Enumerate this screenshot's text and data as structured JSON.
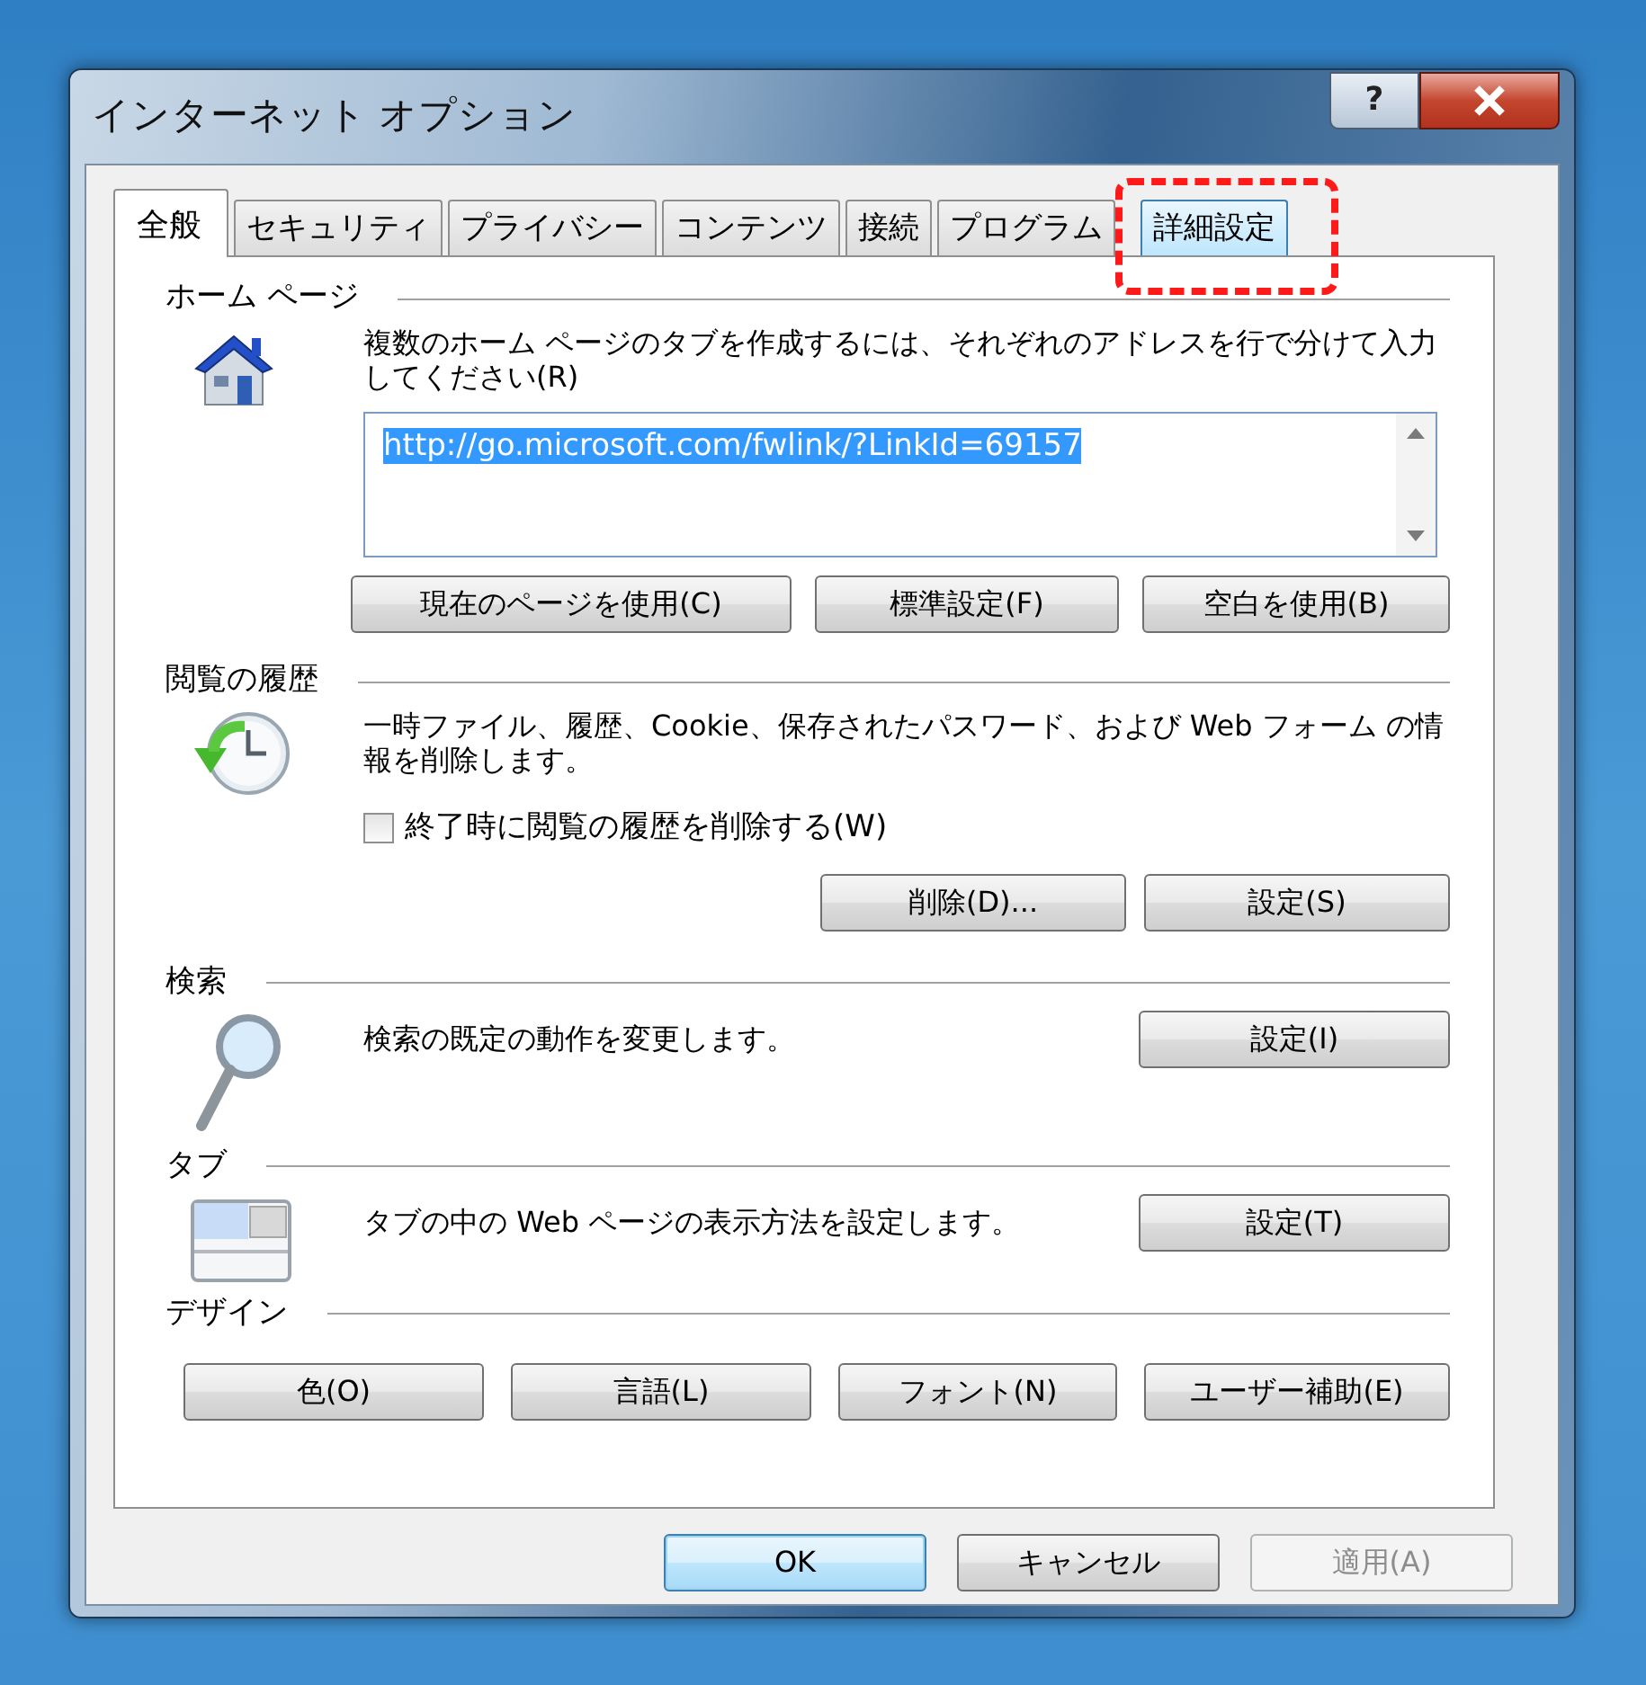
{
  "window": {
    "title": "インターネット オプション",
    "help_button": "?"
  },
  "tabs": [
    {
      "label": "全般",
      "selected": true,
      "highlighted": false,
      "callout": false
    },
    {
      "label": "セキュリティ",
      "selected": false,
      "highlighted": false,
      "callout": false
    },
    {
      "label": "プライバシー",
      "selected": false,
      "highlighted": false,
      "callout": false
    },
    {
      "label": "コンテンツ",
      "selected": false,
      "highlighted": false,
      "callout": false
    },
    {
      "label": "接続",
      "selected": false,
      "highlighted": false,
      "callout": false
    },
    {
      "label": "プログラム",
      "selected": false,
      "highlighted": false,
      "callout": false
    },
    {
      "label": "詳細設定",
      "selected": false,
      "highlighted": true,
      "callout": true
    }
  ],
  "sections": [
    {
      "kind": "home",
      "heading": "ホーム ページ",
      "description": "複数のホーム ページのタブを作成するには、それぞれのアドレスを行で分けて入力してください(R)",
      "field": {
        "value": "http://go.microsoft.com/fwlink/?LinkId=69157",
        "text_selected": true
      },
      "buttons": [
        "現在のページを使用(C)",
        "標準設定(F)",
        "空白を使用(B)"
      ]
    },
    {
      "kind": "history",
      "heading": "閲覧の履歴",
      "description": "一時ファイル、履歴、Cookie、保存されたパスワード、および Web フォーム の情報を削除します。",
      "checkbox": {
        "label": "終了時に閲覧の履歴を削除する(W)",
        "checked": false
      },
      "buttons": [
        "削除(D)...",
        "設定(S)"
      ]
    },
    {
      "kind": "search",
      "heading": "検索",
      "description": "検索の既定の動作を変更します。",
      "buttons": [
        "設定(I)"
      ]
    },
    {
      "kind": "tabs",
      "heading": "タブ",
      "description": "タブの中の Web ページの表示方法を設定します。",
      "buttons": [
        "設定(T)"
      ]
    },
    {
      "kind": "design",
      "heading": "デザイン",
      "buttons": [
        "色(O)",
        "言語(L)",
        "フォント(N)",
        "ユーザー補助(E)"
      ]
    }
  ],
  "footer_buttons": [
    {
      "label": "OK",
      "default": true,
      "disabled": false
    },
    {
      "label": "キャンセル",
      "default": false,
      "disabled": false
    },
    {
      "label": "適用(A)",
      "default": false,
      "disabled": true
    }
  ]
}
